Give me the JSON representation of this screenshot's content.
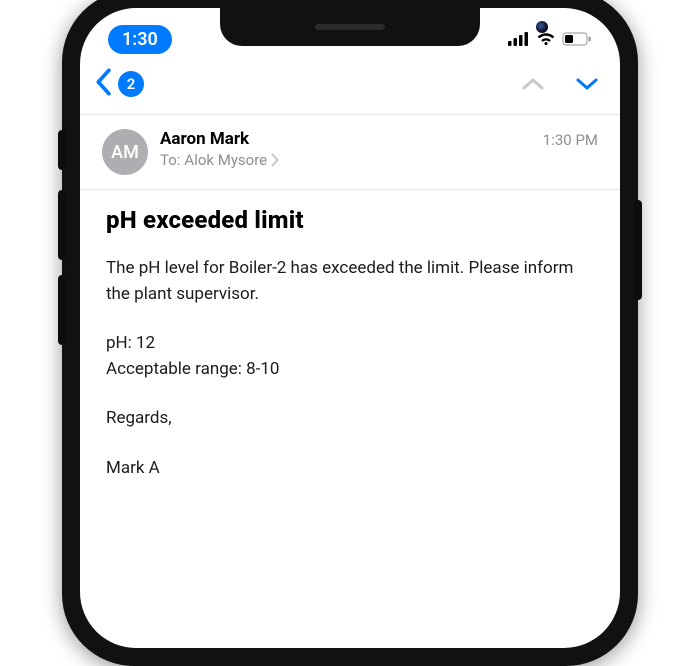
{
  "status_bar": {
    "time": "1:30"
  },
  "nav": {
    "unread_badge": "2"
  },
  "header": {
    "avatar_initials": "AM",
    "sender_name": "Aaron Mark",
    "recipient_label": "To:",
    "recipient_name": "Alok Mysore",
    "time": "1:30 PM"
  },
  "message": {
    "subject": "pH exceeded limit",
    "body_line1": "The pH level for Boiler-2 has exceeded the limit. Please inform the plant supervisor.",
    "ph_line": "pH: 12",
    "range_line": "Acceptable range: 8-10",
    "regards": "Regards,",
    "signature": "Mark A"
  }
}
